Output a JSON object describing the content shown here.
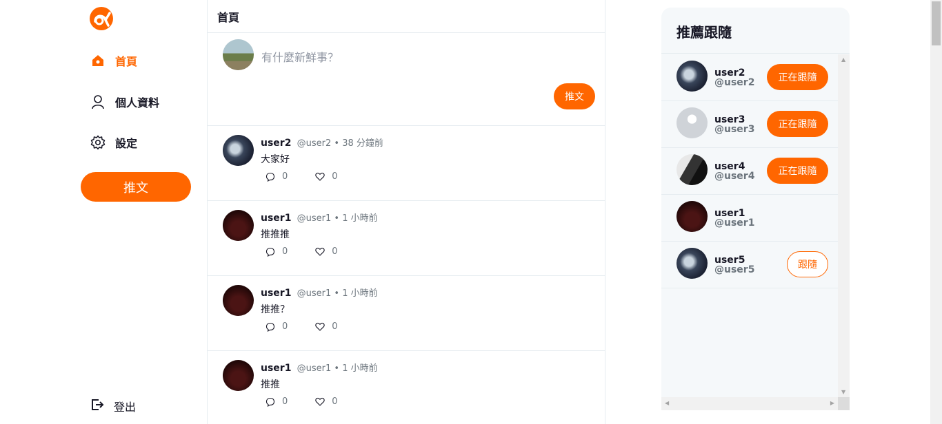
{
  "colors": {
    "accent": "#ff6600",
    "text": "#171725",
    "muted": "#6c757d",
    "panel_bg": "#f5f8fa"
  },
  "nav": {
    "items": [
      {
        "label": "首頁",
        "icon": "home-icon",
        "active": true
      },
      {
        "label": "個人資料",
        "icon": "user-icon",
        "active": false
      },
      {
        "label": "設定",
        "icon": "gear-icon",
        "active": false
      }
    ],
    "tweet_button": "推文",
    "logout": "登出"
  },
  "main": {
    "title": "首頁",
    "composer": {
      "placeholder": "有什麼新鮮事？",
      "post_button": "推文"
    },
    "tweets": [
      {
        "name": "user2",
        "handle": "@user2",
        "time": "38 分鐘前",
        "content": "大家好",
        "replies": "0",
        "likes": "0"
      },
      {
        "name": "user1",
        "handle": "@user1",
        "time": "1 小時前",
        "content": "推推推",
        "replies": "0",
        "likes": "0"
      },
      {
        "name": "user1",
        "handle": "@user1",
        "time": "1 小時前",
        "content": "推推？",
        "replies": "0",
        "likes": "0"
      },
      {
        "name": "user1",
        "handle": "@user1",
        "time": "1 小時前",
        "content": "推推",
        "replies": "0",
        "likes": "0"
      }
    ],
    "meta_separator": "•"
  },
  "follow": {
    "title": "推薦跟隨",
    "users": [
      {
        "name": "user2",
        "handle": "@user2",
        "button": "正在跟隨",
        "following": true
      },
      {
        "name": "user3",
        "handle": "@user3",
        "button": "正在跟隨",
        "following": true
      },
      {
        "name": "user4",
        "handle": "@user4",
        "button": "正在跟隨",
        "following": true
      },
      {
        "name": "user1",
        "handle": "@user1",
        "button": "",
        "following": false
      },
      {
        "name": "user5",
        "handle": "@user5",
        "button": "跟隨",
        "following": false
      }
    ]
  }
}
